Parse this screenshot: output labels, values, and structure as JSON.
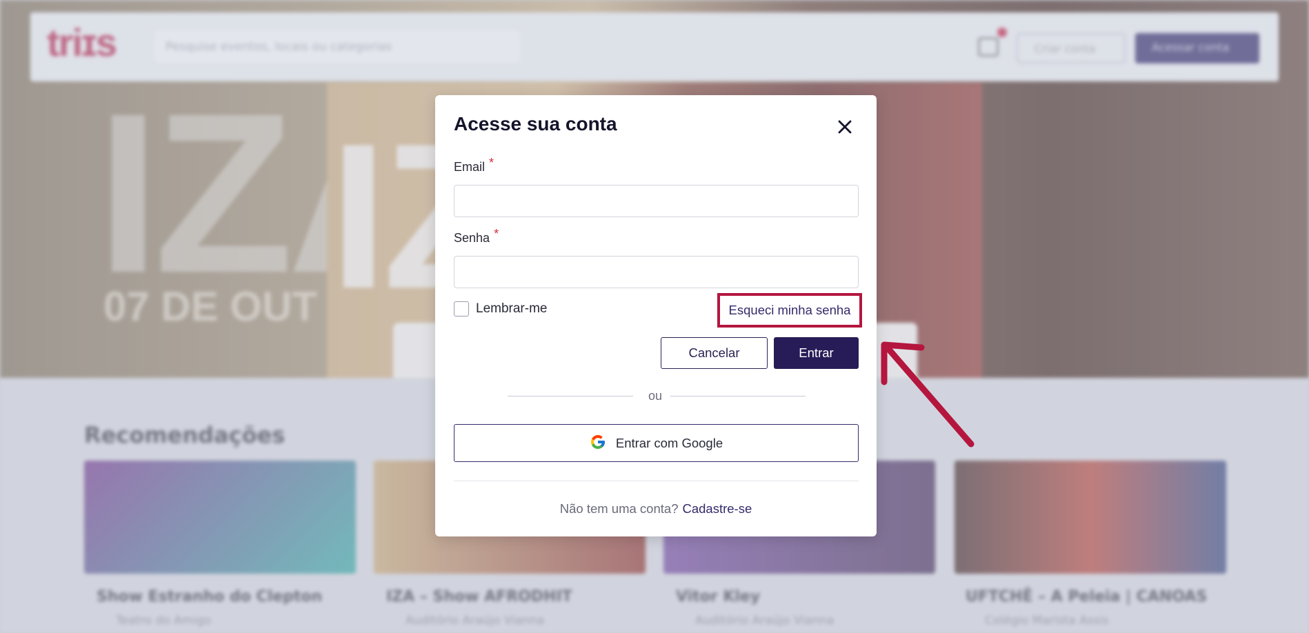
{
  "background": {
    "navbar": {
      "logo": "triɪs",
      "search_placeholder": "Pesquise eventos, locais ou categorias",
      "create_account": "Criar conta",
      "access_account": "Acessar conta"
    },
    "hero": {
      "big_text": "IZA",
      "date_text": "07 DE OUT",
      "poster_text": "IZ"
    },
    "recommendations": {
      "title": "Recomendações",
      "cards": [
        {
          "title": "Show Estranho do Clepton",
          "venue": "Teatro do Amigo"
        },
        {
          "title": "IZA – Show AFRODHIT",
          "venue": "Auditório Araújo Vianna"
        },
        {
          "title": "Vitor Kley",
          "venue": "Auditório Araújo Vianna"
        },
        {
          "title": "UFTCHÊ – A Peleia | CANOAS",
          "venue": "Colégio Marista Assis"
        }
      ]
    }
  },
  "modal": {
    "title": "Acesse sua conta",
    "email_label": "Email",
    "password_label": "Senha",
    "required_mark": "*",
    "email_value": "",
    "password_value": "",
    "remember_label": "Lembrar-me",
    "remember_checked": false,
    "forgot_label": "Esqueci minha senha",
    "cancel_label": "Cancelar",
    "enter_label": "Entrar",
    "divider_text": "ou",
    "google_label": "Entrar com Google",
    "no_account_text": "Não tem uma conta?",
    "signup_label": "Cadastre-se"
  },
  "colors": {
    "primary": "#271c57",
    "highlight": "#b4163e",
    "required": "#d92b3a"
  },
  "icons": {
    "close": "close-icon",
    "google": "google-icon",
    "annotation": "arrow-icon"
  }
}
